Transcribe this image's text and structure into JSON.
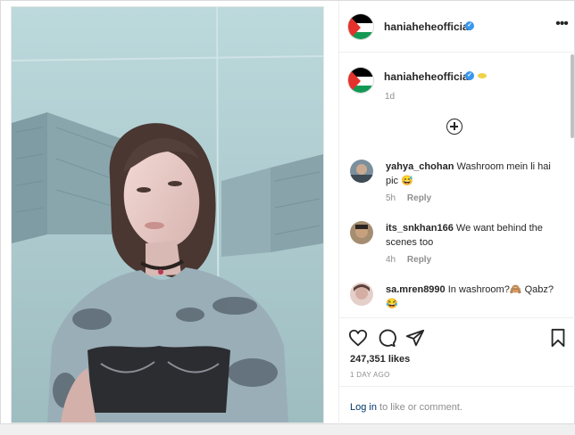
{
  "post": {
    "username": "haniaheheofficial",
    "caption_time": "1d",
    "likes": "247,351 likes",
    "date": "1 DAY AGO"
  },
  "comments": [
    {
      "user": "yahya_chohan",
      "text": "Washroom mein li hai pic 😅",
      "time": "5h",
      "reply": "Reply"
    },
    {
      "user": "its_snkhan166",
      "text": "We want behind the scenes too",
      "time": "4h",
      "reply": "Reply"
    },
    {
      "user": "sa.mren8990",
      "text": "In washroom?🙈 Qabz? 😂",
      "time": "",
      "reply": ""
    }
  ],
  "login": {
    "link": "Log in",
    "rest": " to like or comment."
  },
  "icons": {
    "verified": "verified-badge-icon",
    "more": "more-options-icon",
    "add": "load-more-comments-icon",
    "like": "heart-icon",
    "comment": "comment-icon",
    "share": "share-icon",
    "save": "bookmark-icon"
  },
  "colors": {
    "verified": "#3897f0",
    "link": "#00376b",
    "muted": "#8e8e8e"
  }
}
